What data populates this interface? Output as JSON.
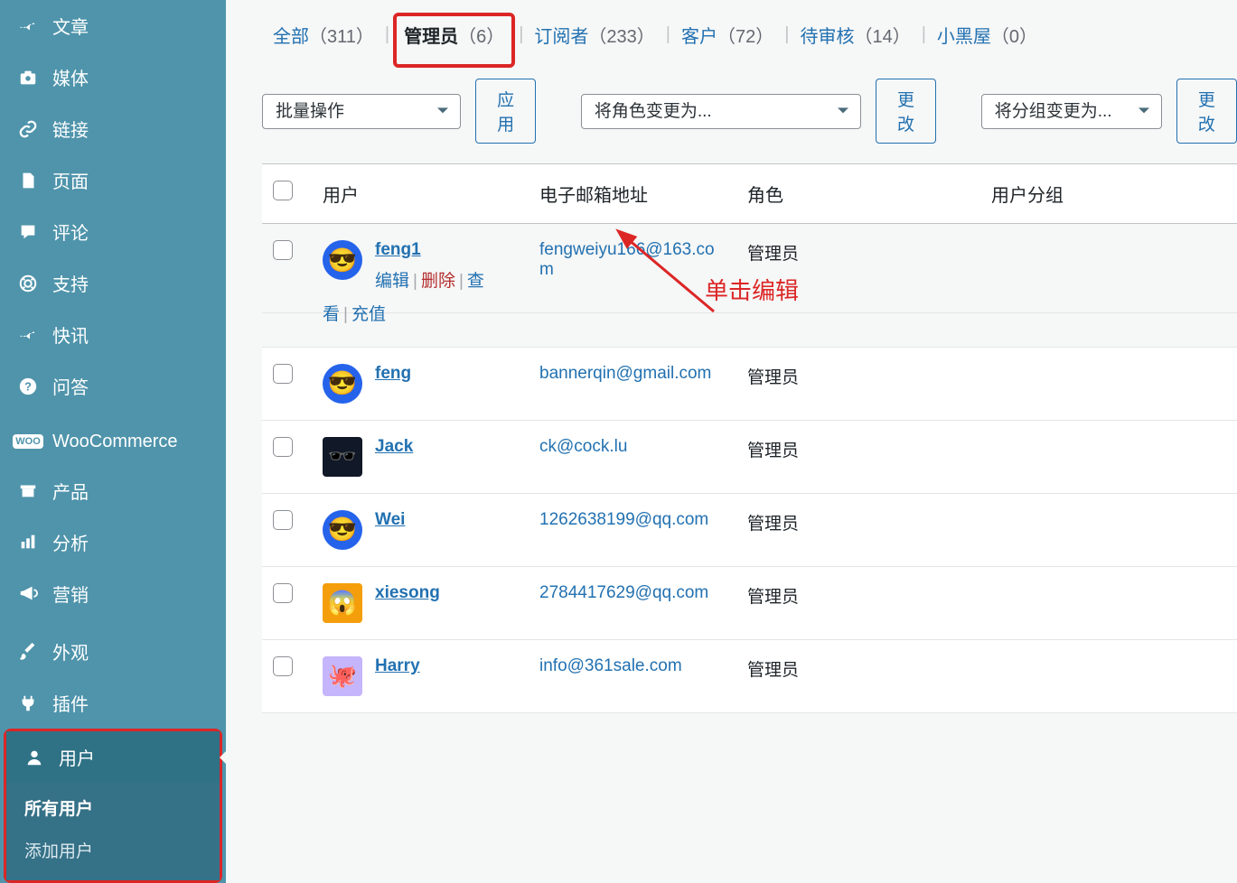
{
  "sidebar": {
    "items": [
      {
        "label": "文章",
        "name": "posts",
        "icon": "pin"
      },
      {
        "label": "媒体",
        "name": "media",
        "icon": "camera"
      },
      {
        "label": "链接",
        "name": "links",
        "icon": "link"
      },
      {
        "label": "页面",
        "name": "pages",
        "icon": "page"
      },
      {
        "label": "评论",
        "name": "comments",
        "icon": "comment"
      },
      {
        "label": "支持",
        "name": "support",
        "icon": "life"
      },
      {
        "label": "快讯",
        "name": "news",
        "icon": "pin"
      },
      {
        "label": "问答",
        "name": "qa",
        "icon": "question"
      },
      {
        "label": "WooCommerce",
        "name": "woocommerce",
        "icon": "woo"
      },
      {
        "label": "产品",
        "name": "products",
        "icon": "archive"
      },
      {
        "label": "分析",
        "name": "analytics",
        "icon": "chart"
      },
      {
        "label": "营销",
        "name": "marketing",
        "icon": "megaphone"
      },
      {
        "label": "外观",
        "name": "appearance",
        "icon": "brush"
      },
      {
        "label": "插件",
        "name": "plugins",
        "icon": "plug"
      },
      {
        "label": "用户",
        "name": "users",
        "icon": "user"
      }
    ],
    "submenu": {
      "all_users": "所有用户",
      "add_user": "添加用户"
    }
  },
  "filters": {
    "all": {
      "label": "全部",
      "count": "（311）"
    },
    "admin": {
      "label": "管理员",
      "count": "（6）"
    },
    "subscriber": {
      "label": "订阅者",
      "count": "（233）"
    },
    "customer": {
      "label": "客户",
      "count": "（72）"
    },
    "pending": {
      "label": "待审核",
      "count": "（14）"
    },
    "banned": {
      "label": "小黑屋",
      "count": "（0）"
    }
  },
  "actions": {
    "bulk_placeholder": "批量操作",
    "apply_label": "应用",
    "role_placeholder": "将角色变更为...",
    "change_label": "更改",
    "group_placeholder": "将分组变更为...",
    "change2_label": "更改"
  },
  "table_headers": {
    "user": "用户",
    "email": "电子邮箱地址",
    "role": "角色",
    "group": "用户分组"
  },
  "row_actions": {
    "edit": "编辑",
    "delete": "删除",
    "view_pre": "查",
    "view_post": "看",
    "recharge": "充值"
  },
  "users": [
    {
      "username": "feng1",
      "email": "fengweiyu166@163.com",
      "role": "管理员",
      "avatar": {
        "shape": "round",
        "bg": "#2563eb",
        "emoji": "😎"
      }
    },
    {
      "username": "feng",
      "email": "bannerqin@gmail.com",
      "role": "管理员",
      "avatar": {
        "shape": "round",
        "bg": "#2563eb",
        "emoji": "😎"
      }
    },
    {
      "username": "Jack",
      "email": "ck@cock.lu",
      "role": "管理员",
      "avatar": {
        "shape": "square",
        "bg": "#111827",
        "emoji": "🕶️"
      }
    },
    {
      "username": "Wei",
      "email": "1262638199@qq.com",
      "role": "管理员",
      "avatar": {
        "shape": "round",
        "bg": "#2563eb",
        "emoji": "😎"
      }
    },
    {
      "username": "xiesong",
      "email": "2784417629@qq.com",
      "role": "管理员",
      "avatar": {
        "shape": "square",
        "bg": "#f59e0b",
        "emoji": "😱"
      }
    },
    {
      "username": "Harry",
      "email": "info@361sale.com",
      "role": "管理员",
      "avatar": {
        "shape": "square",
        "bg": "#c4b5fd",
        "emoji": "🐙"
      }
    }
  ],
  "annotation": {
    "text": "单击编辑"
  }
}
